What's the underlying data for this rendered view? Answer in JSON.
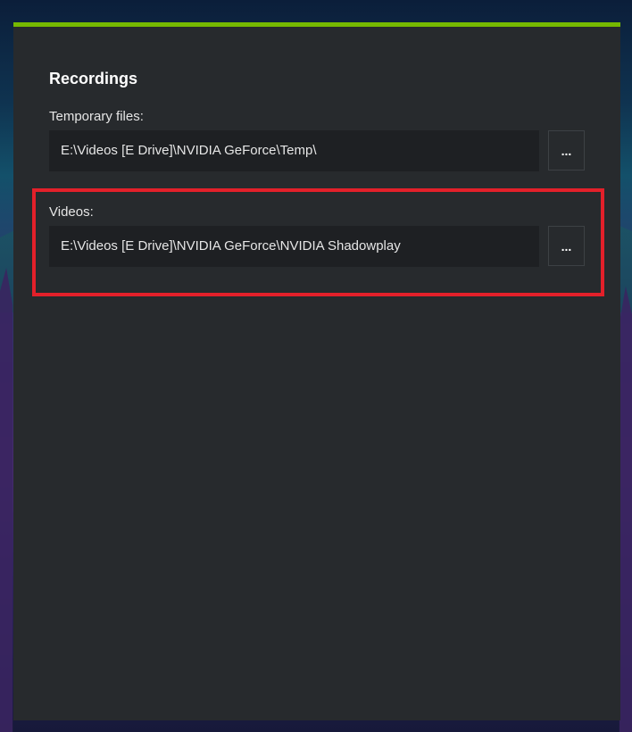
{
  "recordings": {
    "title": "Recordings",
    "temporary_files": {
      "label": "Temporary files:",
      "path": "E:\\Videos [E Drive]\\NVIDIA GeForce\\Temp\\",
      "browse_label": "..."
    },
    "videos": {
      "label": "Videos:",
      "path": "E:\\Videos [E Drive]\\NVIDIA GeForce\\NVIDIA Shadowplay",
      "browse_label": "..."
    }
  },
  "colors": {
    "accent": "#76b900",
    "panel_background": "#272a2d",
    "field_background": "#1e2023",
    "highlight": "#e3202a"
  }
}
